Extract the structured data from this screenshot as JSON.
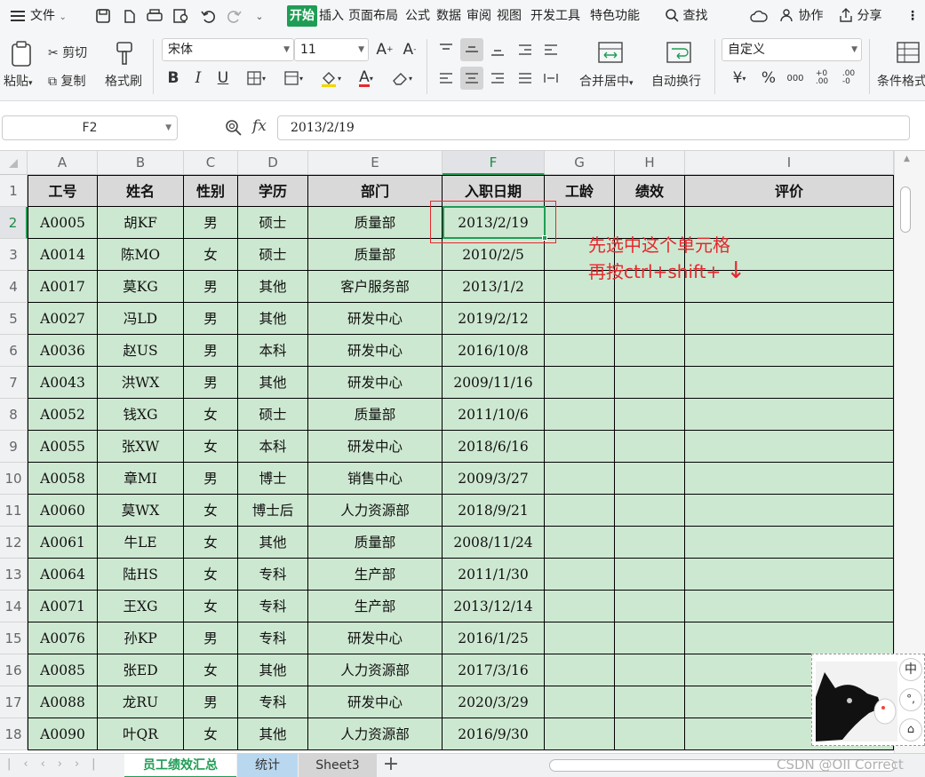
{
  "menubar": {
    "file_label": "文件",
    "tabs": [
      "开始",
      "插入",
      "页面布局",
      "公式",
      "数据",
      "审阅",
      "视图",
      "开发工具",
      "特色功能"
    ],
    "search_label": "查找",
    "collab_label": "协作",
    "share_label": "分享"
  },
  "ribbon": {
    "paste_label": "粘贴",
    "cut_label": "剪切",
    "copy_label": "复制",
    "format_painter_label": "格式刷",
    "font_name": "宋体",
    "font_size": "11",
    "merge_label": "合并居中",
    "wrap_label": "自动换行",
    "number_format": "自定义",
    "cond_format_label": "条件格式"
  },
  "formula_bar": {
    "name_box": "F2",
    "fx_symbol": "fx",
    "value": "2013/2/19"
  },
  "grid": {
    "columns": [
      "A",
      "B",
      "C",
      "D",
      "E",
      "F",
      "G",
      "H",
      "I"
    ],
    "selected_column": "F",
    "selected_row": "2",
    "header_row": [
      "工号",
      "姓名",
      "性别",
      "学历",
      "部门",
      "入职日期",
      "工龄",
      "绩效",
      "评价"
    ],
    "rows": [
      {
        "n": "2",
        "cells": [
          "A0005",
          "胡KF",
          "男",
          "硕士",
          "质量部",
          "2013/2/19",
          "",
          "",
          ""
        ]
      },
      {
        "n": "3",
        "cells": [
          "A0014",
          "陈MO",
          "女",
          "硕士",
          "质量部",
          "2010/2/5",
          "",
          "",
          ""
        ]
      },
      {
        "n": "4",
        "cells": [
          "A0017",
          "莫KG",
          "男",
          "其他",
          "客户服务部",
          "2013/1/2",
          "",
          "",
          ""
        ]
      },
      {
        "n": "5",
        "cells": [
          "A0027",
          "冯LD",
          "男",
          "其他",
          "研发中心",
          "2019/2/12",
          "",
          "",
          ""
        ]
      },
      {
        "n": "6",
        "cells": [
          "A0036",
          "赵US",
          "男",
          "本科",
          "研发中心",
          "2016/10/8",
          "",
          "",
          ""
        ]
      },
      {
        "n": "7",
        "cells": [
          "A0043",
          "洪WX",
          "男",
          "其他",
          "研发中心",
          "2009/11/16",
          "",
          "",
          ""
        ]
      },
      {
        "n": "8",
        "cells": [
          "A0052",
          "钱XG",
          "女",
          "硕士",
          "质量部",
          "2011/10/6",
          "",
          "",
          ""
        ]
      },
      {
        "n": "9",
        "cells": [
          "A0055",
          "张XW",
          "女",
          "本科",
          "研发中心",
          "2018/6/16",
          "",
          "",
          ""
        ]
      },
      {
        "n": "10",
        "cells": [
          "A0058",
          "章MI",
          "男",
          "博士",
          "销售中心",
          "2009/3/27",
          "",
          "",
          ""
        ]
      },
      {
        "n": "11",
        "cells": [
          "A0060",
          "莫WX",
          "女",
          "博士后",
          "人力资源部",
          "2018/9/21",
          "",
          "",
          ""
        ]
      },
      {
        "n": "12",
        "cells": [
          "A0061",
          "牛LE",
          "女",
          "其他",
          "质量部",
          "2008/11/24",
          "",
          "",
          ""
        ]
      },
      {
        "n": "13",
        "cells": [
          "A0064",
          "陆HS",
          "女",
          "专科",
          "生产部",
          "2011/1/30",
          "",
          "",
          ""
        ]
      },
      {
        "n": "14",
        "cells": [
          "A0071",
          "王XG",
          "女",
          "专科",
          "生产部",
          "2013/12/14",
          "",
          "",
          ""
        ]
      },
      {
        "n": "15",
        "cells": [
          "A0076",
          "孙KP",
          "男",
          "专科",
          "研发中心",
          "2016/1/25",
          "",
          "",
          ""
        ]
      },
      {
        "n": "16",
        "cells": [
          "A0085",
          "张ED",
          "女",
          "其他",
          "人力资源部",
          "2017/3/16",
          "",
          "",
          ""
        ]
      },
      {
        "n": "17",
        "cells": [
          "A0088",
          "龙RU",
          "男",
          "专科",
          "研发中心",
          "2020/3/29",
          "",
          "",
          ""
        ]
      },
      {
        "n": "18",
        "cells": [
          "A0090",
          "叶QR",
          "女",
          "其他",
          "人力资源部",
          "2016/9/30",
          "",
          "",
          ""
        ]
      }
    ]
  },
  "annotation": {
    "line1": "先选中这个单元格",
    "line2": "再按ctrl+shift+",
    "arrow": "↓",
    "color": "#e8262d"
  },
  "sheets": {
    "tabs": [
      "员工绩效汇总",
      "统计",
      "Sheet3"
    ],
    "active": "员工绩效汇总",
    "add_label": "+"
  },
  "ime": {
    "chinese_label": "中",
    "punct_label": "°,"
  },
  "watermark": "CSDN @OII Correct",
  "colors": {
    "accent": "#1f9d55",
    "header_fill": "#d9d9d9",
    "body_fill": "#cde8d1",
    "selection_border": "#1f9d55"
  }
}
